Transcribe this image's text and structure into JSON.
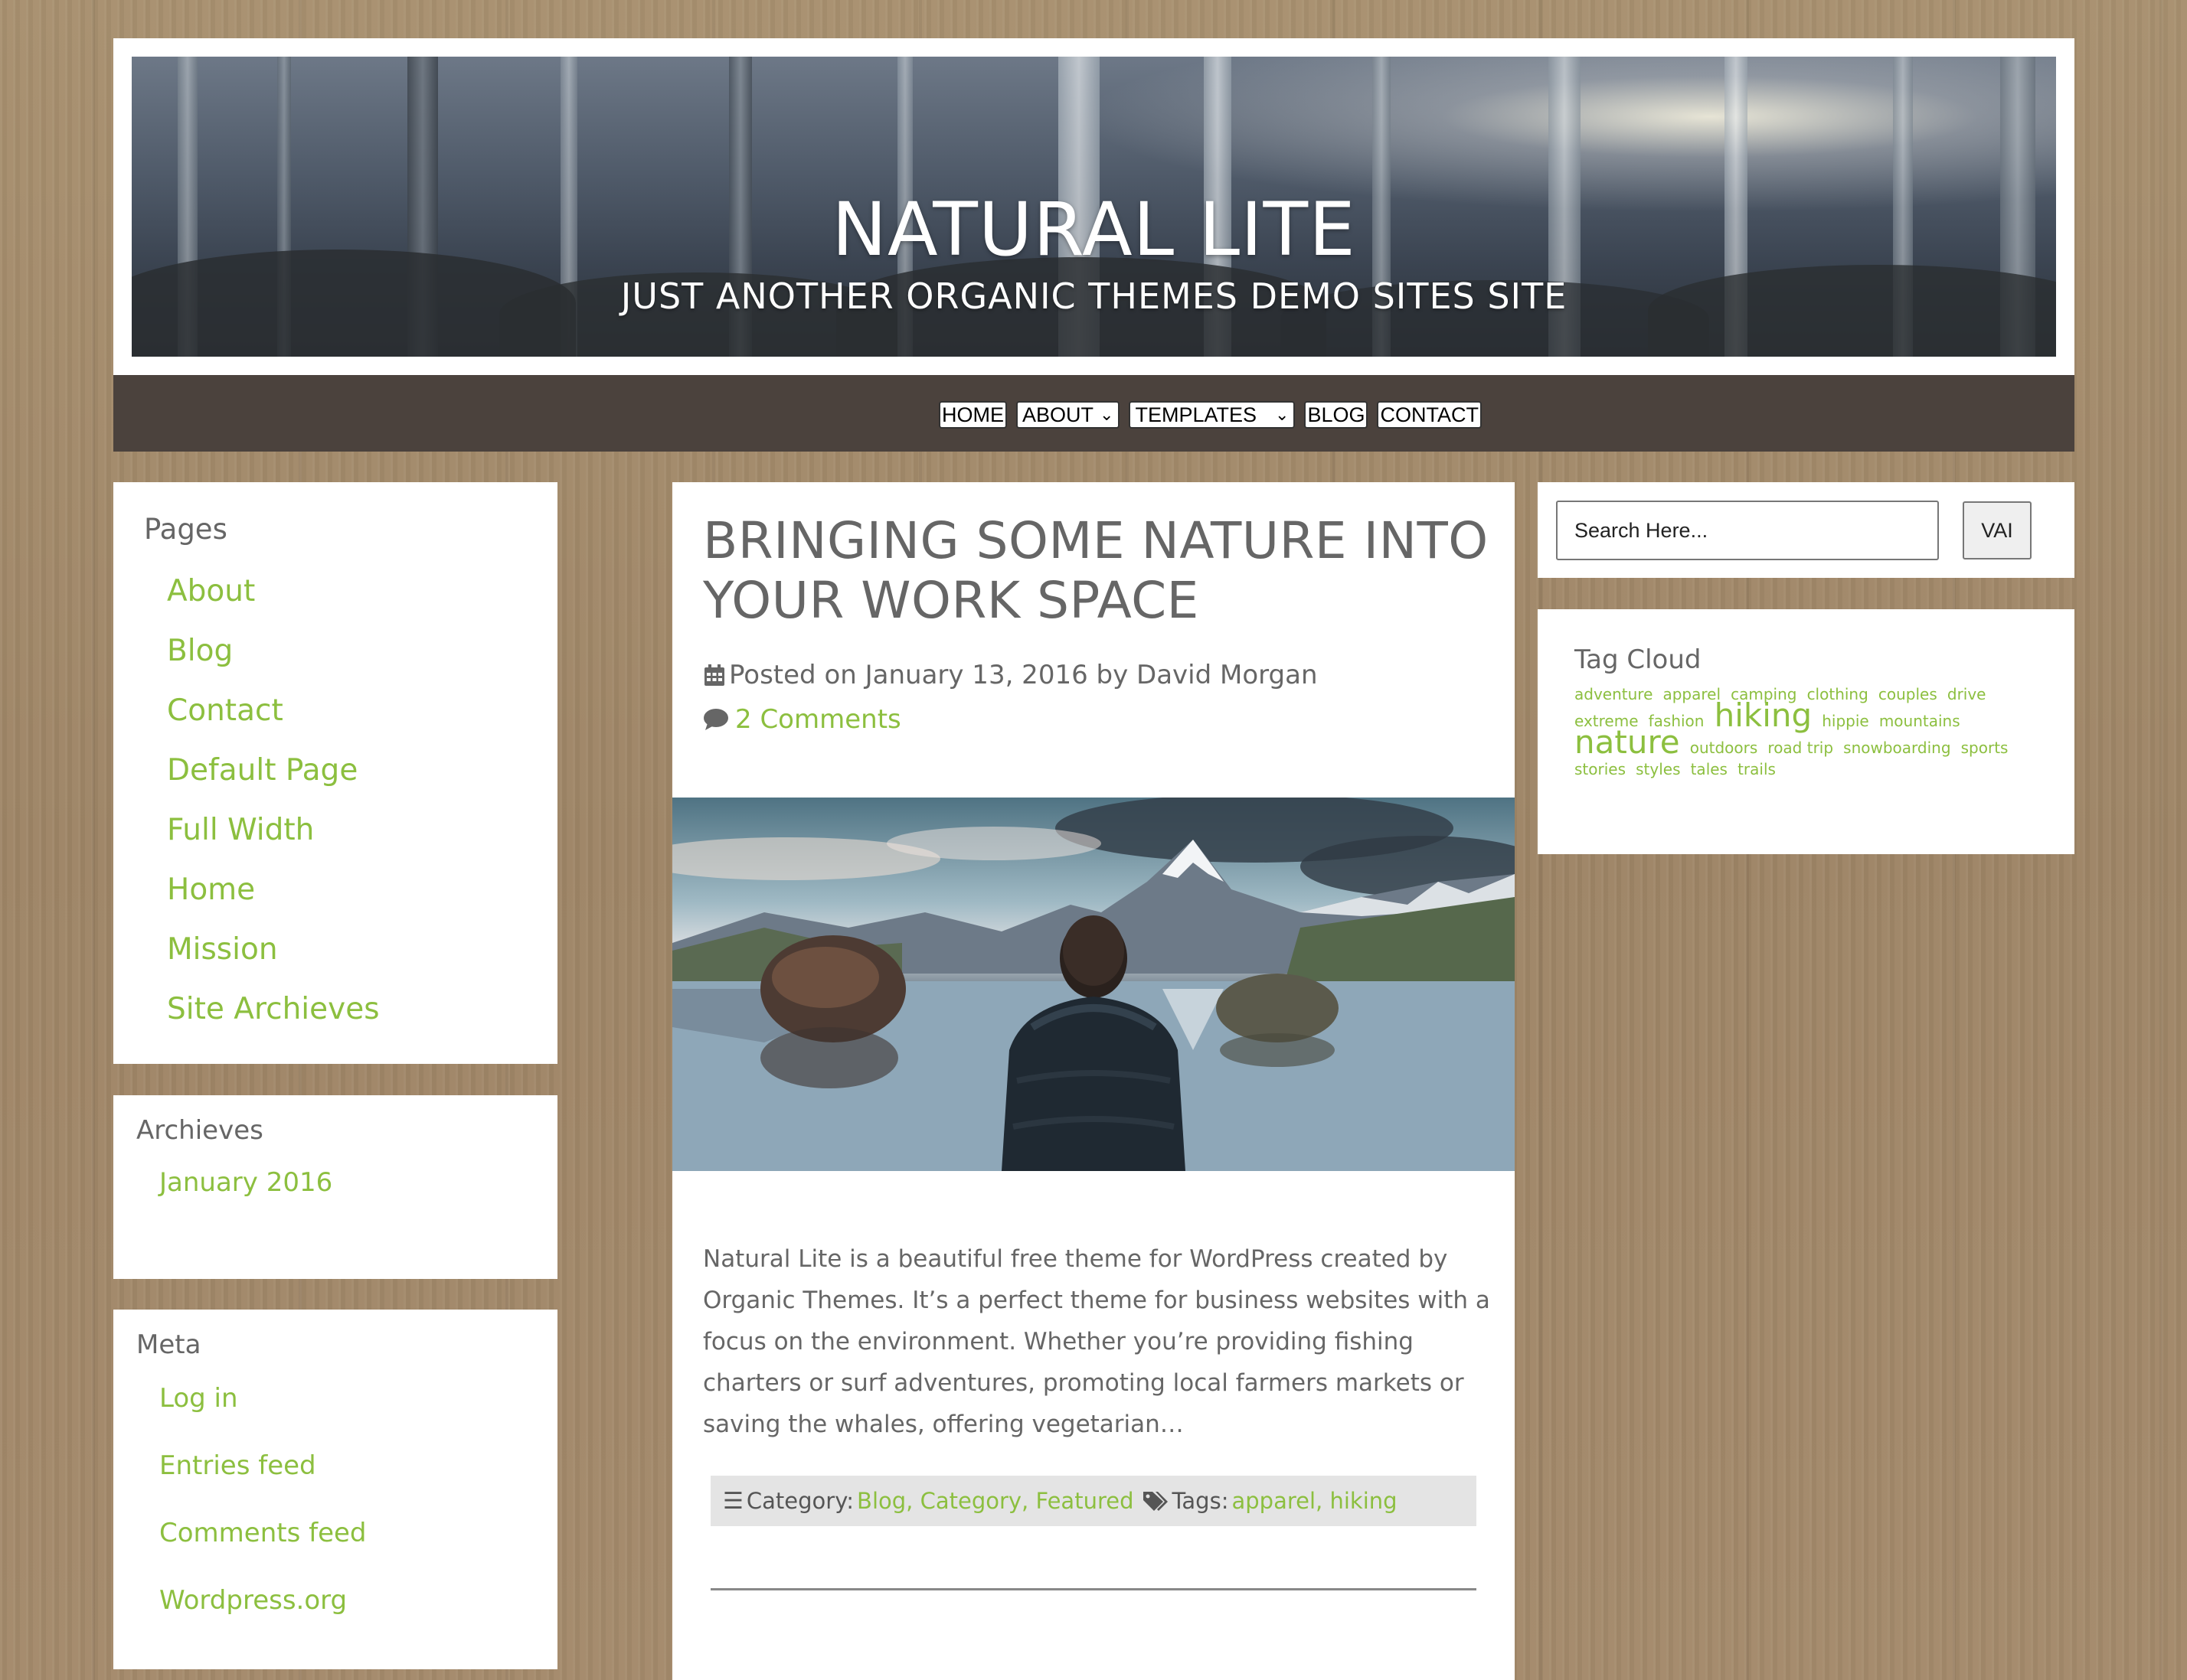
{
  "header": {
    "title": "NATURAL LITE",
    "tagline": "JUST ANOTHER ORGANIC THEMES DEMO SITES SITE"
  },
  "nav": {
    "items": [
      {
        "label": "HOME"
      },
      {
        "label": "ABOUT",
        "dropdown": true
      },
      {
        "label": "TEMPLATES",
        "dropdown": true
      },
      {
        "label": "BLOG"
      },
      {
        "label": "CONTACT"
      }
    ]
  },
  "sidebar_left": {
    "pages_title": "Pages",
    "pages": [
      "About",
      "Blog",
      "Contact",
      "Default Page",
      "Full Width",
      "Home",
      "Mission",
      "Site Archieves"
    ],
    "archives_title": "Archieves",
    "archives": [
      "January 2016"
    ],
    "meta_title": "Meta",
    "meta": [
      "Log in",
      "Entries feed",
      "Comments feed",
      "Wordpress.org"
    ]
  },
  "post": {
    "title": "BRINGING SOME NATURE INTO YOUR WORK SPACE",
    "meta": "Posted on January 13, 2016 by David Morgan",
    "comments": "2 Comments",
    "excerpt": "Natural Lite is a beautiful free theme for WordPress created by Organic Themes. It’s a perfect theme for business websites with a focus on the environment. Whether you’re providing fishing charters or surf adventures, promoting local farmers markets or saving the whales, offering vegetarian…",
    "category_label": "Category:",
    "categories": "Blog, Category, Featured",
    "tags_label": "Tags:",
    "tags": "apparel, hiking"
  },
  "sidebar_right": {
    "search_placeholder": "Search Here...",
    "search_button": "VAI",
    "tags_title": "Tag Cloud",
    "tag_cloud": [
      {
        "label": "adventure",
        "size": "small"
      },
      {
        "label": "apparel",
        "size": "small"
      },
      {
        "label": "camping",
        "size": "small"
      },
      {
        "label": "clothing",
        "size": "small"
      },
      {
        "label": "couples",
        "size": "small"
      },
      {
        "label": "drive",
        "size": "small"
      },
      {
        "label": "extreme",
        "size": "small"
      },
      {
        "label": "fashion",
        "size": "small"
      },
      {
        "label": "hiking",
        "size": "large"
      },
      {
        "label": "hippie",
        "size": "small"
      },
      {
        "label": "mountains",
        "size": "small"
      },
      {
        "label": "nature",
        "size": "large"
      },
      {
        "label": "outdoors",
        "size": "small"
      },
      {
        "label": "road trip",
        "size": "small"
      },
      {
        "label": "snowboarding",
        "size": "small"
      },
      {
        "label": "sports",
        "size": "small"
      },
      {
        "label": "stories",
        "size": "small"
      },
      {
        "label": "styles",
        "size": "small"
      },
      {
        "label": "tales",
        "size": "small"
      },
      {
        "label": "trails",
        "size": "small"
      }
    ]
  },
  "colors": {
    "accent": "#8cbf3f",
    "nav_bg": "#4b423d",
    "text": "#666666"
  },
  "icons": {
    "calendar": "calendar-icon",
    "comment": "comment-icon",
    "category": "list-icon",
    "tags": "tags-icon",
    "chevron": "chevron-down-icon"
  }
}
